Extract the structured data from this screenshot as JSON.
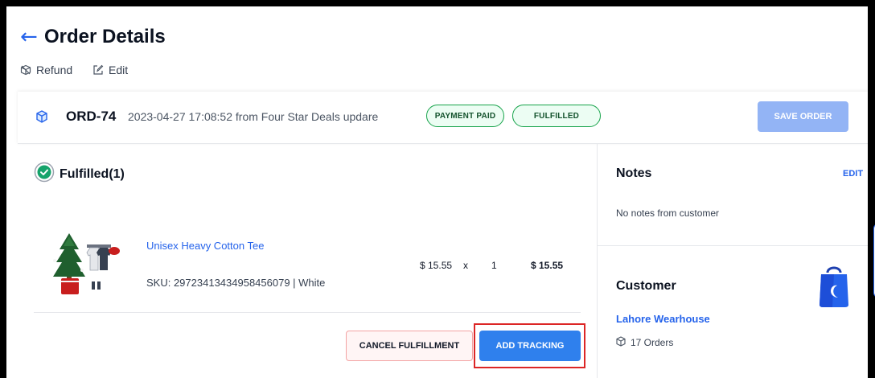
{
  "header": {
    "back_symbol": "←",
    "title": "Order Details",
    "actions": {
      "refund": "Refund",
      "edit": "Edit"
    }
  },
  "order": {
    "id": "ORD-74",
    "meta": "2023-04-27 17:08:52 from Four Star Deals updare",
    "badges": {
      "payment": "PAYMENT PAID",
      "fulfillment": "FULFILLED"
    },
    "save_label": "SAVE ORDER"
  },
  "fulfillment": {
    "title": "Fulfilled(1)",
    "item": {
      "name": "Unisex Heavy Cotton Tee",
      "sku": "SKU: 29723413434958456079 | White",
      "price": "$ 15.55",
      "times": "x",
      "qty": "1",
      "total": "$ 15.55"
    },
    "cancel_label": "CANCEL FULFILLMENT",
    "tracking_label": "ADD TRACKING"
  },
  "notes": {
    "title": "Notes",
    "edit_label": "EDIT",
    "text": "No notes from customer"
  },
  "customer": {
    "title": "Customer",
    "name": "Lahore Wearhouse",
    "orders": "17 Orders"
  },
  "colors": {
    "accent": "#2f80ed",
    "badge_border": "#16a34a",
    "highlight": "#dc2626"
  },
  "icons": [
    "back-arrow-icon",
    "refund-icon",
    "edit-icon",
    "cube-icon",
    "check-circle-icon",
    "box-icon",
    "shopping-bag-icon"
  ]
}
